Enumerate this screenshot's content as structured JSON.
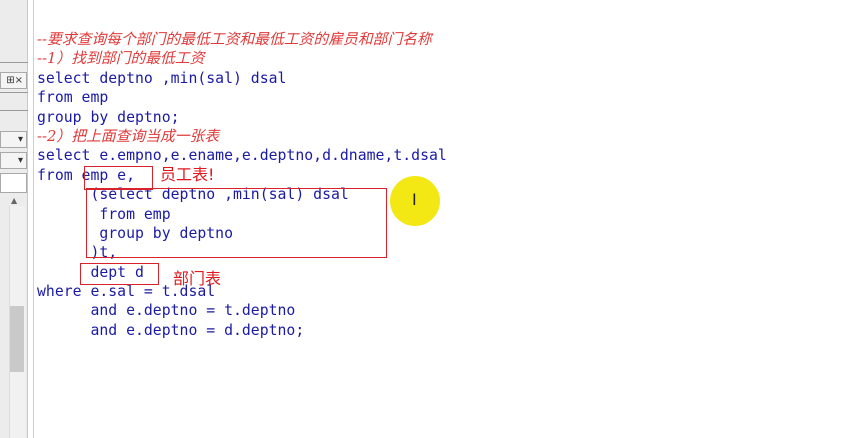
{
  "left_panel": {
    "pin_glyph": "⊞",
    "close_glyph": "×",
    "dropdown_glyph": "▾",
    "scroll_up_glyph": "▲"
  },
  "editor": {
    "lines": [
      "--要求查询每个部门的最低工资和最低工资的雇员和部门名称",
      "--1）找到部门的最低工资",
      "select deptno ,min(sal) dsal",
      "from emp",
      "group by deptno;",
      "--2）把上面查询当成一张表",
      "select e.empno,e.ename,e.deptno,d.dname,t.dsal",
      "from emp e,",
      "      (select deptno ,min(sal) dsal",
      "       from emp",
      "       group by deptno",
      "      )t,",
      "      dept d",
      "where e.sal = t.dsal",
      "      and e.deptno = t.deptno",
      "      and e.deptno = d.deptno;"
    ]
  },
  "annotations": {
    "emp_label": "员工表!",
    "dept_label": "部门表"
  },
  "colors": {
    "code": "#1a1aa6",
    "comment": "#e03a3a",
    "annotation": "#d8232a",
    "cursor_highlight": "#f2e600"
  },
  "cursor": {
    "glyph": "I"
  }
}
